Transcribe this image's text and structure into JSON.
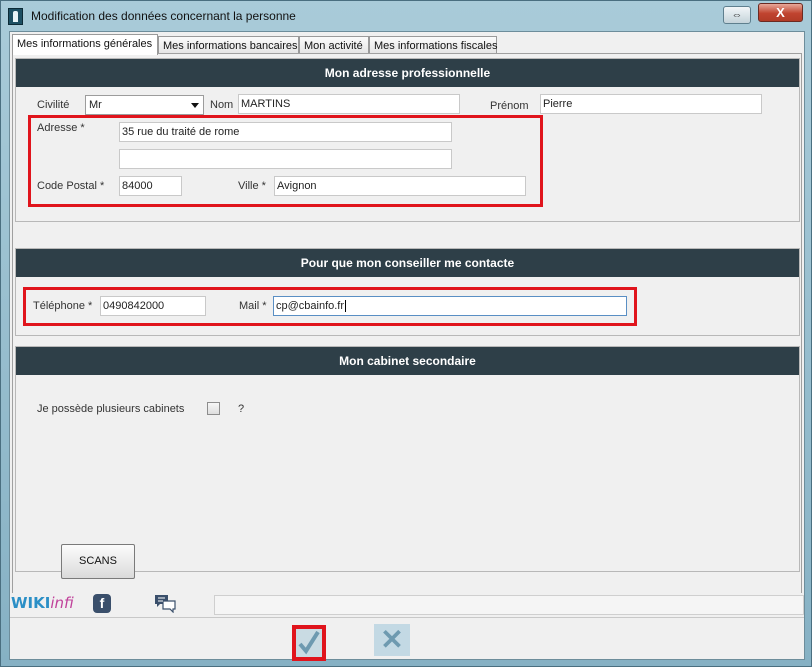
{
  "window": {
    "title": "Modification des données concernant la personne",
    "close_label": "X",
    "restore_label": "⇔"
  },
  "tabs": [
    {
      "label": "Mes informations générales",
      "active": true
    },
    {
      "label": "Mes informations bancaires",
      "active": false
    },
    {
      "label": "Mon activité",
      "active": false
    },
    {
      "label": "Mes informations fiscales",
      "active": false
    }
  ],
  "adresse_pro": {
    "heading": "Mon adresse professionnelle",
    "civilite_label": "Civilité",
    "civilite_value": "Mr",
    "nom_label": "Nom",
    "nom_value": "MARTINS",
    "prenom_label": "Prénom",
    "prenom_value": "Pierre",
    "adresse_label": "Adresse *",
    "adresse_line1": "35 rue du traité de rome",
    "adresse_line2": "",
    "cp_label": "Code Postal *",
    "cp_value": "84000",
    "ville_label": "Ville *",
    "ville_value": "Avignon"
  },
  "contact": {
    "heading": "Pour que mon conseiller me contacte",
    "telephone_label": "Téléphone *",
    "telephone_value": "0490842000",
    "mail_label": "Mail *",
    "mail_value": "cp@cbainfo.fr"
  },
  "cabinet": {
    "heading": "Mon cabinet secondaire",
    "question_label": "Je possède plusieurs cabinets",
    "help": "?",
    "checked": false
  },
  "scans_label": "SCANS",
  "linkbar": {
    "wiki_part1": "WIKI",
    "wiki_part2": "infi",
    "facebook_glyph": "f"
  },
  "footer": {
    "ok_glyph": "✓",
    "cancel_glyph": "✕"
  },
  "colors": {
    "section_header": "#2e3f48",
    "highlight": "#e0141c",
    "window_frame": "#a9cbd9"
  }
}
